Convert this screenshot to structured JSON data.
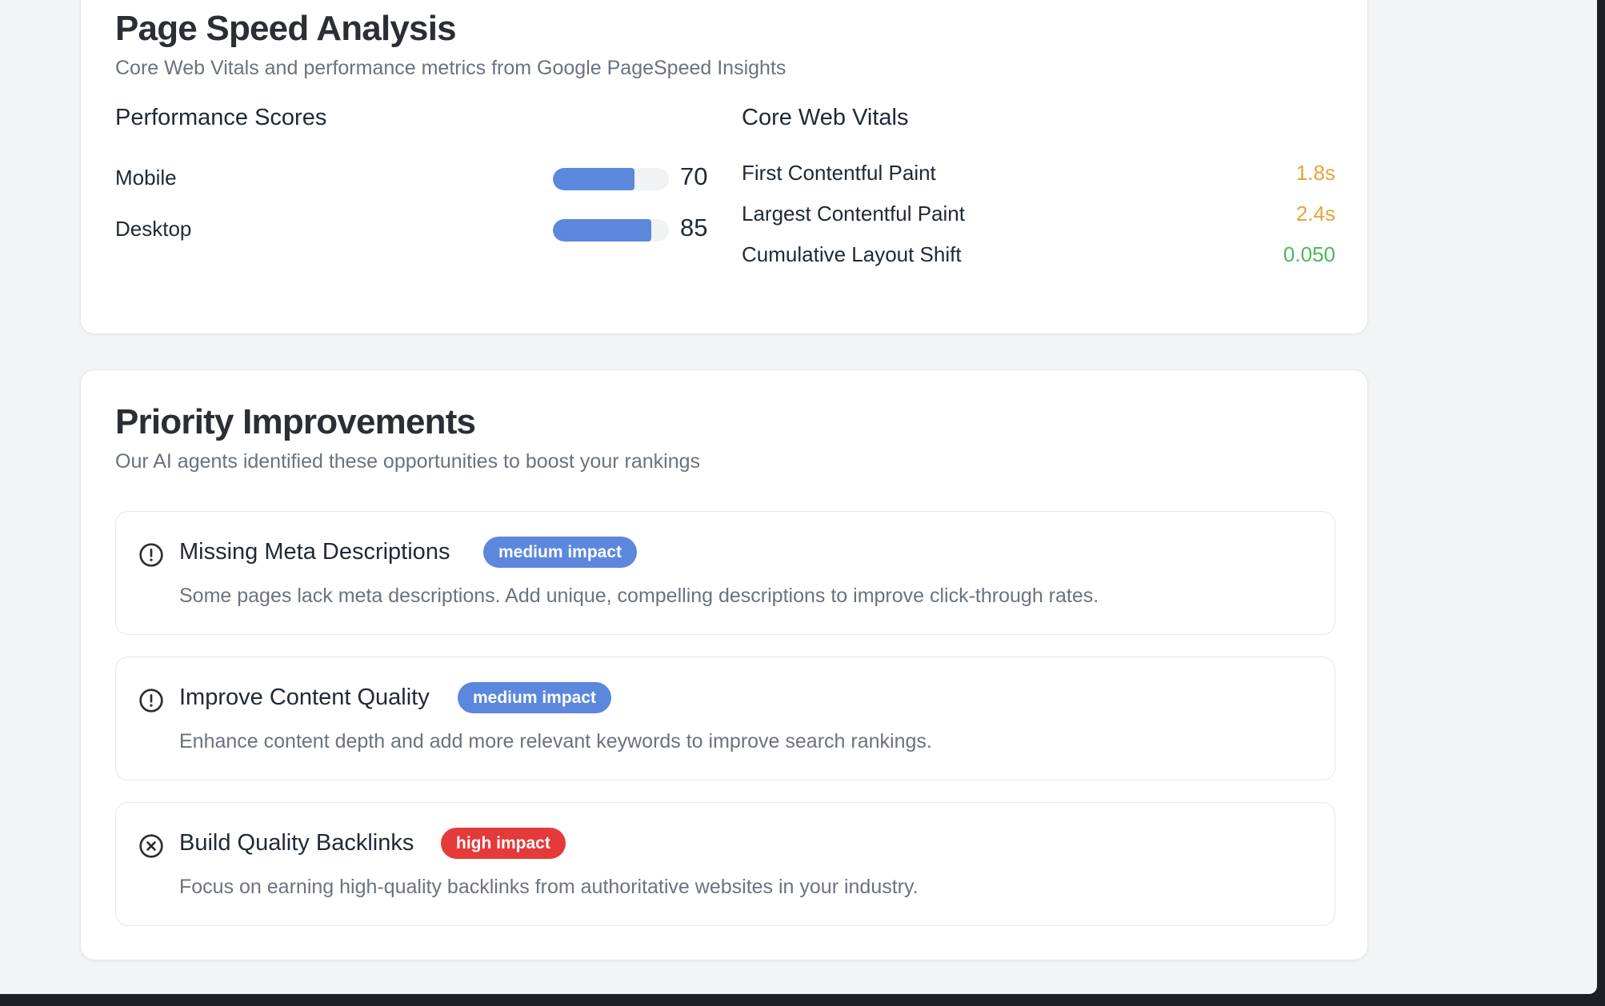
{
  "page_speed": {
    "title": "Page Speed Analysis",
    "subtitle": "Core Web Vitals and performance metrics from Google PageSpeed Insights",
    "performance_scores": {
      "title": "Performance Scores",
      "items": [
        {
          "label": "Mobile",
          "score": "70",
          "fill_fraction": 0.7
        },
        {
          "label": "Desktop",
          "score": "85",
          "fill_fraction": 0.85
        }
      ],
      "bar_color": "#5b87dd"
    },
    "core_web_vitals": {
      "title": "Core Web Vitals",
      "items": [
        {
          "label": "First Contentful Paint",
          "value": "1.8s",
          "color": "#e8a33c"
        },
        {
          "label": "Largest Contentful Paint",
          "value": "2.4s",
          "color": "#e8a33c"
        },
        {
          "label": "Cumulative Layout Shift",
          "value": "0.050",
          "color": "#4cb85c"
        }
      ]
    }
  },
  "priority_improvements": {
    "title": "Priority Improvements",
    "subtitle": "Our AI agents identified these opportunities to boost your rankings",
    "items": [
      {
        "icon": "alert-circle-icon",
        "title": "Missing Meta Descriptions",
        "badge": "medium impact",
        "badge_color": "#5b87dd",
        "description": "Some pages lack meta descriptions. Add unique, compelling descriptions to improve click-through rates."
      },
      {
        "icon": "alert-circle-icon",
        "title": "Improve Content Quality",
        "badge": "medium impact",
        "badge_color": "#5b87dd",
        "description": "Enhance content depth and add more relevant keywords to improve search rankings."
      },
      {
        "icon": "x-circle-icon",
        "title": "Build Quality Backlinks",
        "badge": "high impact",
        "badge_color": "#e53a3a",
        "description": "Focus on earning high-quality backlinks from authoritative websites in your industry."
      }
    ]
  }
}
